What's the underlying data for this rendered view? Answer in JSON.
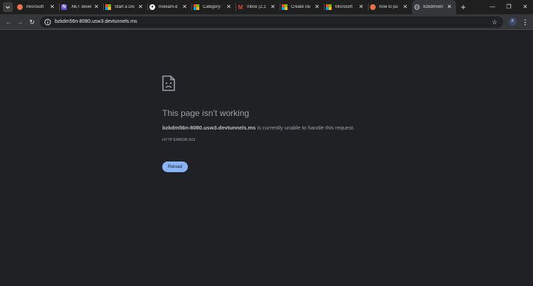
{
  "browser": {
    "tabs": [
      {
        "title": "microsoft",
        "favicon": "recipe-round-icon",
        "color": "#e8714a",
        "active": false
      },
      {
        "title": ".NET devel",
        "favicon": "dotnet-icon",
        "color": "#6d4fd6",
        "active": false
      },
      {
        "title": "Start a Dis",
        "favicon": "microsoft-logo-icon",
        "color": "",
        "active": false
      },
      {
        "title": "msleam-d",
        "favicon": "github-icon",
        "color": "#ffffff",
        "active": false
      },
      {
        "title": "Category:",
        "favicon": "microsoft-logo-icon",
        "color": "",
        "active": false
      },
      {
        "title": "Inbox (2,1",
        "favicon": "gmail-icon",
        "color": "#ea4335",
        "active": false
      },
      {
        "title": "Create clu",
        "favicon": "microsoft-logo-icon",
        "color": "",
        "active": false
      },
      {
        "title": "Microsoft",
        "favicon": "microsoft-logo-icon",
        "color": "",
        "active": false
      },
      {
        "title": "how to pu",
        "favicon": "recipe-round-icon",
        "color": "#e8714a",
        "active": false
      },
      {
        "title": "bzkdm56n",
        "favicon": "globe-icon",
        "color": "#bdc1c6",
        "active": true
      }
    ],
    "new_tab_symbol": "+",
    "window_controls": {
      "minimize": "—",
      "restore": "❐",
      "close": "✕"
    },
    "nav": {
      "back": "←",
      "forward": "→",
      "reload": "↻"
    },
    "address": "bzkdm56n-8080.usw3.devtunnels.ms",
    "bookmark_symbol": "☆",
    "profile_initial": "K",
    "menu_symbol": "⋮"
  },
  "error_page": {
    "title": "This page isn’t working",
    "host": "bzkdm56n-8080.usw3.devtunnels.ms",
    "message": " is currently unable to handle this request.",
    "code": "HTTP ERROR 502",
    "reload_label": "Reload"
  },
  "colors": {
    "page_bg": "#202124",
    "toolbar_bg": "#35363a",
    "reload_button": "#8ab4f8"
  }
}
